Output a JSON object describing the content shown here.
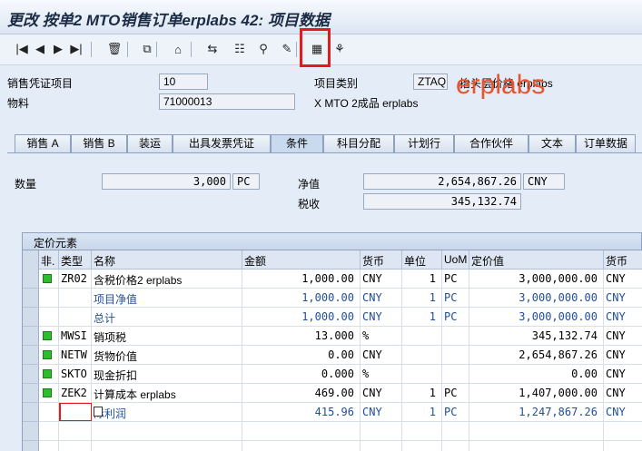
{
  "window": {
    "title": "更改 按单2 MTO销售订单erplabs 42: 项目数据"
  },
  "toolbar": {
    "buttons": [
      {
        "name": "first-page-icon",
        "glyph": "|◀"
      },
      {
        "name": "prev-page-icon",
        "glyph": "◀"
      },
      {
        "name": "next-page-icon",
        "glyph": "▶"
      },
      {
        "name": "last-page-icon",
        "glyph": "▶|"
      },
      {
        "name": "delete-icon",
        "glyph": "🗑"
      },
      {
        "name": "copy-icon",
        "glyph": "⧉"
      },
      {
        "name": "header-icon",
        "glyph": "⌂"
      },
      {
        "name": "document-flow-icon",
        "glyph": "⇆"
      },
      {
        "name": "overview-icon",
        "glyph": "☷"
      },
      {
        "name": "display-icon",
        "glyph": "⚲"
      },
      {
        "name": "create-icon",
        "glyph": "✎"
      },
      {
        "name": "calculator-icon",
        "glyph": "▦"
      },
      {
        "name": "configure-icon",
        "glyph": "⚘"
      }
    ]
  },
  "header": {
    "sales_doc_item_label": "销售凭证项目",
    "sales_doc_item_value": "10",
    "item_category_label": "项目类别",
    "item_category_value": "ZTAQ",
    "item_category_desc": "抬头层价格 erplabs",
    "material_label": "物料",
    "material_value": "71000013",
    "material_desc": "X MTO 2成品 erplabs",
    "watermark": "erplabs"
  },
  "tabs": [
    {
      "label": "销售 A",
      "active": false
    },
    {
      "label": "销售 B",
      "active": false
    },
    {
      "label": "装运",
      "active": false
    },
    {
      "label": "出具发票凭证",
      "active": false
    },
    {
      "label": "条件",
      "active": true
    },
    {
      "label": "科目分配",
      "active": false
    },
    {
      "label": "计划行",
      "active": false
    },
    {
      "label": "合作伙伴",
      "active": false
    },
    {
      "label": "文本",
      "active": false
    },
    {
      "label": "订单数据",
      "active": false
    }
  ],
  "conditions": {
    "quantity_label": "数量",
    "quantity_value": "3,000",
    "quantity_unit": "PC",
    "net_value_label": "净值",
    "net_value": "2,654,867.26",
    "net_currency": "CNY",
    "tax_label": "税收",
    "tax_value": "345,132.74"
  },
  "pricing": {
    "section_title": "定价元素",
    "columns": [
      "非.",
      "类型",
      "名称",
      "金额",
      "货币",
      "单位",
      "UoM",
      "定价值",
      "货币"
    ],
    "rows": [
      {
        "light": true,
        "type": "ZR02",
        "name": "含税价格2 erplabs",
        "amount": "1,000.00",
        "curr": "CNY",
        "unit": "1",
        "uom": "PC",
        "value": "3,000,000.00",
        "vcurr": "CNY",
        "blue": false
      },
      {
        "light": false,
        "type": "",
        "name": "项目净值",
        "amount": "1,000.00",
        "curr": "CNY",
        "unit": "1",
        "uom": "PC",
        "value": "3,000,000.00",
        "vcurr": "CNY",
        "blue": true
      },
      {
        "light": false,
        "type": "",
        "name": "总计",
        "amount": "1,000.00",
        "curr": "CNY",
        "unit": "1",
        "uom": "PC",
        "value": "3,000,000.00",
        "vcurr": "CNY",
        "blue": true
      },
      {
        "light": true,
        "type": "MWSI",
        "name": "销项税",
        "amount": "13.000",
        "curr": "%",
        "unit": "",
        "uom": "",
        "value": "345,132.74",
        "vcurr": "CNY",
        "blue": false
      },
      {
        "light": true,
        "type": "NETW",
        "name": "货物价值",
        "amount": "0.00",
        "curr": "CNY",
        "unit": "",
        "uom": "",
        "value": "2,654,867.26",
        "vcurr": "CNY",
        "blue": false
      },
      {
        "light": true,
        "type": "SKTO",
        "name": "现金折扣",
        "amount": "0.000",
        "curr": "%",
        "unit": "",
        "uom": "",
        "value": "0.00",
        "vcurr": "CNY",
        "blue": false
      },
      {
        "light": true,
        "type": "ZEK2",
        "name": "计算成本 erplabs",
        "amount": "469.00",
        "curr": "CNY",
        "unit": "1",
        "uom": "PC",
        "value": "1,407,000.00",
        "vcurr": "CNY",
        "blue": false
      },
      {
        "light": false,
        "type": "",
        "name": "际利润",
        "amount": "415.96",
        "curr": "CNY",
        "unit": "1",
        "uom": "PC",
        "value": "1,247,867.26",
        "vcurr": "CNY",
        "blue": true
      },
      {
        "light": false,
        "type": "",
        "name": "",
        "amount": "",
        "curr": "",
        "unit": "",
        "uom": "",
        "value": "",
        "vcurr": "",
        "blue": false
      },
      {
        "light": false,
        "type": "",
        "name": "",
        "amount": "",
        "curr": "",
        "unit": "",
        "uom": "",
        "value": "",
        "vcurr": "",
        "blue": false
      }
    ]
  }
}
